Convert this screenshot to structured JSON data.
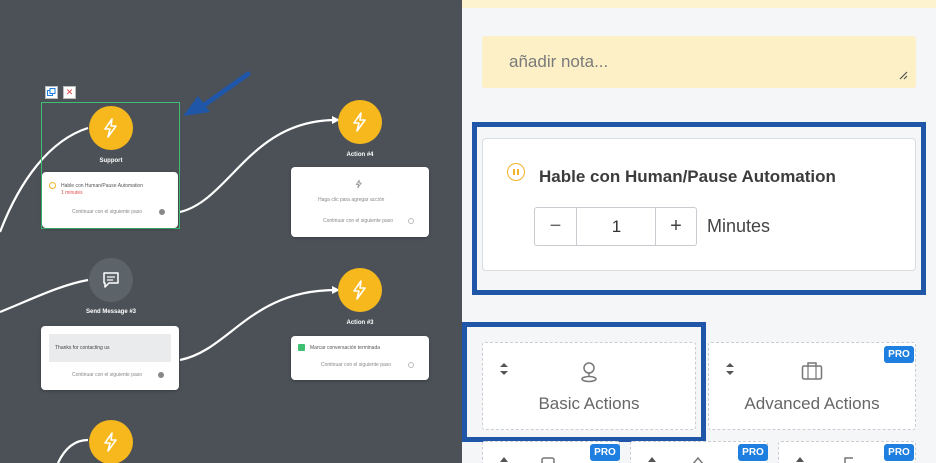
{
  "canvas": {
    "nodes": {
      "support": {
        "title": "Support",
        "row_text": "Hable con Human/Pause Automation",
        "row_sub": "1 minutes",
        "continue_text": "Continuar con el siguiente paso"
      },
      "action4": {
        "title": "Action #4",
        "placeholder": "Haga clic para agregar acción",
        "continue_text": "Continuar con el siguiente paso"
      },
      "send3": {
        "title": "Send Message #3",
        "message": "Thanks for contacting us",
        "continue_text": "Continuar con el siguiente paso"
      },
      "action3": {
        "title": "Action #3",
        "row_text": "Marcar conversación terminada",
        "continue_text": "Continuar con el siguiente paso"
      }
    }
  },
  "panel": {
    "note_placeholder": "añadir nota...",
    "pause_action": {
      "title": "Hable con Human/Pause Automation",
      "value": "1",
      "unit": "Minutes",
      "minus": "−",
      "plus": "+"
    },
    "action_tiles": [
      {
        "label": "Basic Actions",
        "icon": "map-pin-icon",
        "pro": false
      },
      {
        "label": "Advanced Actions",
        "icon": "briefcase-icon",
        "pro": true
      }
    ],
    "pro_label": "PRO"
  },
  "colors": {
    "canvas_bg": "#4b5157",
    "node_yellow": "#f6b81d",
    "highlight_blue": "#1f56a8",
    "pro_blue": "#1f7fe0",
    "note_bg": "#fdf0c6",
    "pause_icon": "#f0b429",
    "selected_green": "#3fbf72"
  }
}
